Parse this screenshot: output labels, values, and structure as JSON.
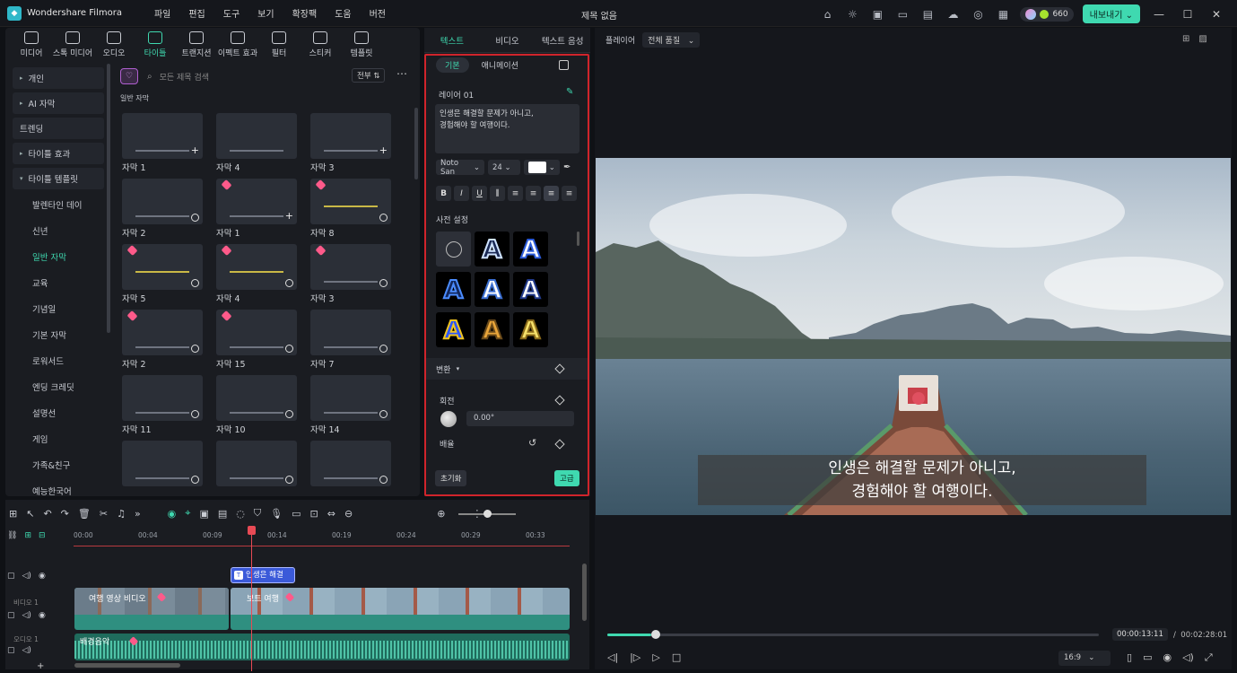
{
  "titlebar": {
    "app_name": "Wondershare Filmora",
    "menu": [
      "파일",
      "편집",
      "도구",
      "보기",
      "확장팩",
      "도움",
      "버전"
    ],
    "doc_title": "제목 없음",
    "credits": "660",
    "export_label": "내보내기"
  },
  "categories": [
    {
      "label": "미디어",
      "icon": "media-icon"
    },
    {
      "label": "스톡 미디어",
      "icon": "stock-icon"
    },
    {
      "label": "오디오",
      "icon": "music-icon"
    },
    {
      "label": "타이틀",
      "icon": "title-icon",
      "active": true
    },
    {
      "label": "트랜지션",
      "icon": "transition-icon"
    },
    {
      "label": "이펙트 효과",
      "icon": "effects-icon"
    },
    {
      "label": "필터",
      "icon": "filter-icon"
    },
    {
      "label": "스티커",
      "icon": "sticker-icon"
    },
    {
      "label": "템플릿",
      "icon": "template-icon"
    }
  ],
  "sidebar": [
    {
      "label": "개인",
      "arrow": "▸",
      "boxed": true
    },
    {
      "label": "AI 자막",
      "arrow": "▸",
      "boxed": true
    },
    {
      "label": "트렌딩",
      "boxed": true
    },
    {
      "label": "타이틀 효과",
      "arrow": "▸",
      "boxed": true
    },
    {
      "label": "타이틀 템플릿",
      "arrow": "▾",
      "boxed": true
    },
    {
      "label": "발렌타인 데이",
      "sub": true
    },
    {
      "label": "신년",
      "sub": true
    },
    {
      "label": "일반 자막",
      "sub": true,
      "active": true
    },
    {
      "label": "교육",
      "sub": true
    },
    {
      "label": "기념일",
      "sub": true
    },
    {
      "label": "기본 자막",
      "sub": true
    },
    {
      "label": "로워서드",
      "sub": true
    },
    {
      "label": "엔딩 크레딧",
      "sub": true
    },
    {
      "label": "설명선",
      "sub": true
    },
    {
      "label": "게임",
      "sub": true
    },
    {
      "label": "가족&친구",
      "sub": true
    },
    {
      "label": "예능한국어",
      "sub": true
    }
  ],
  "search": {
    "placeholder": "모든 제목 검색",
    "filter_label": "전부"
  },
  "section_label": "일반 자막",
  "cards": [
    {
      "label": "자막 1",
      "badge": "plus"
    },
    {
      "label": "자막 4",
      "badge": "none"
    },
    {
      "label": "자막 3",
      "badge": "plus"
    },
    {
      "label": "자막 2",
      "badge": "download"
    },
    {
      "label": "자막 1",
      "badge": "plus",
      "gem": true
    },
    {
      "label": "자막 8",
      "badge": "download",
      "gem": true
    },
    {
      "label": "자막 5",
      "badge": "download",
      "gem": true
    },
    {
      "label": "자막 4",
      "badge": "download",
      "gem": true
    },
    {
      "label": "자막 3",
      "badge": "download",
      "gem": true
    },
    {
      "label": "자막 2",
      "badge": "download",
      "gem": true
    },
    {
      "label": "자막 15",
      "badge": "download",
      "gem": true
    },
    {
      "label": "자막 7",
      "badge": "download"
    },
    {
      "label": "자막 11",
      "badge": "download"
    },
    {
      "label": "자막 10",
      "badge": "download"
    },
    {
      "label": "자막 14",
      "badge": "download"
    },
    {
      "label": "",
      "badge": "download"
    },
    {
      "label": "",
      "badge": "download"
    },
    {
      "label": "",
      "badge": "download"
    }
  ],
  "props": {
    "tabs": [
      "텍스트",
      "비디오",
      "텍스트 음성"
    ],
    "subtabs": [
      "기본",
      "애니메이션"
    ],
    "layer_label": "레이어 01",
    "text_value": "인생은 해결할 문제가 아니고,\n경험해야 할 여행이다.",
    "font": "Noto San",
    "size": "24",
    "preset_label": "사전 설정",
    "transform_label": "변환",
    "rotate_label": "회전",
    "rotate_value": "0.00°",
    "scale_label": "배율",
    "reset_label": "초기화",
    "advanced_label": "고급"
  },
  "player": {
    "label": "플레이어",
    "quality": "전체 품질",
    "subtitle_line1": "인생은 해결할 문제가 아니고,",
    "subtitle_line2": "경험해야 할 여행이다.",
    "current_time": "00:00:13:11",
    "total_time": "00:02:28:01",
    "separator": "/",
    "ratio": "16:9",
    "progress": 0.09
  },
  "timeline": {
    "ticks": [
      "00:00",
      "00:04",
      "00:09",
      "00:14",
      "00:19",
      "00:24",
      "00:29",
      "00:33"
    ],
    "track_video": "비디오 1",
    "track_audio": "오디오 1",
    "text_clip": "인생은 해결",
    "video_clip1": "여행 영상 비디오",
    "video_clip2": "보트 여행",
    "audio_clip": "배경음악"
  }
}
